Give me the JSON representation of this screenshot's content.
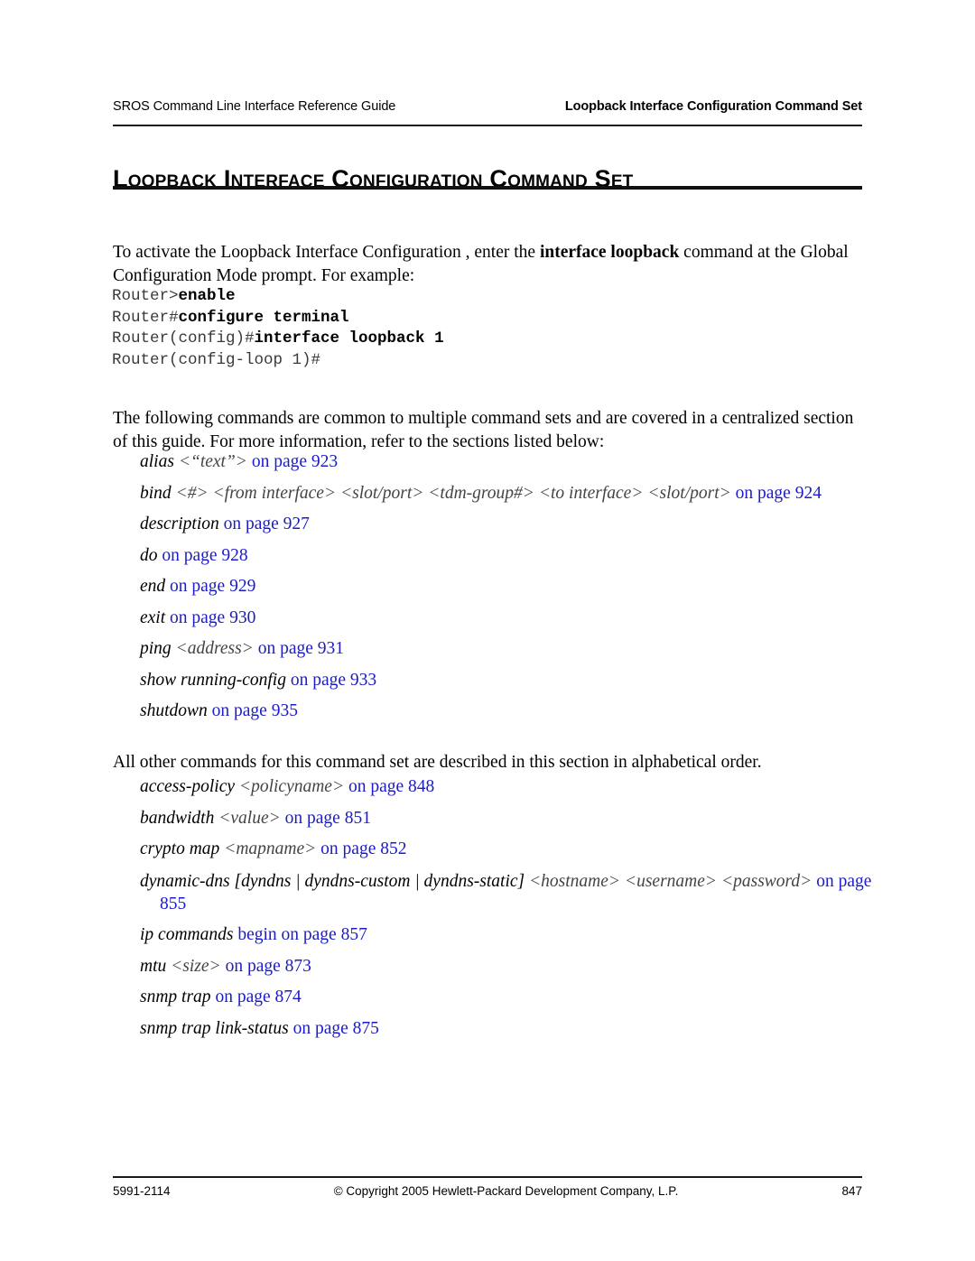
{
  "header": {
    "left": "SROS Command Line Interface Reference Guide",
    "right": "Loopback Interface Configuration Command Set"
  },
  "title": "Loopback Interface Configuration Command Set",
  "paragraphs": {
    "intro_before": "To activate the Loopback Interface Configuration , enter the ",
    "intro_bold": "interface loopback",
    "intro_after": " command at the Global Configuration Mode prompt. For example:",
    "common": "The following commands are common to multiple command sets and are covered in a centralized section of this guide. For more information, refer to the sections listed below:",
    "other": "All other commands for this command set are described in this section in alphabetical order."
  },
  "code_block": [
    {
      "prompt": "Router>",
      "typed": "enable"
    },
    {
      "prompt": "Router#",
      "typed": "configure terminal"
    },
    {
      "prompt": "Router(config)#",
      "typed": "interface loopback 1"
    },
    {
      "prompt": "Router(config-loop 1)#",
      "typed": ""
    }
  ],
  "common_commands": [
    {
      "cmd": "alias ",
      "arg": "<“text”>",
      "link": " on page 923"
    },
    {
      "cmd": "bind ",
      "arg": "<#> <from interface> <slot/port> <tdm-group#> <to interface> <slot/port>",
      "link": " on page 924"
    },
    {
      "cmd": "description",
      "arg": "",
      "link": " on page 927"
    },
    {
      "cmd": "do",
      "arg": "",
      "link": " on page 928"
    },
    {
      "cmd": "end",
      "arg": "",
      "link": " on page 929"
    },
    {
      "cmd": "exit",
      "arg": "",
      "link": " on page 930"
    },
    {
      "cmd": "ping ",
      "arg": "<address>",
      "link": " on page 931"
    },
    {
      "cmd": "show running-config",
      "arg": "",
      "link": " on page 933"
    },
    {
      "cmd": "shutdown",
      "arg": "",
      "link": " on page 935"
    }
  ],
  "other_commands": [
    {
      "cmd": "access-policy ",
      "arg": "<policyname>",
      "link": " on page 848",
      "wrapped": false
    },
    {
      "cmd": "bandwidth ",
      "arg": "<value>",
      "link": " on page 851",
      "wrapped": false
    },
    {
      "cmd": "crypto map ",
      "arg": "<mapname>",
      "link": " on page 852",
      "wrapped": false
    },
    {
      "cmd": "dynamic-dns [dyndns | dyndns-custom | dyndns-static] ",
      "arg": "<hostname> <username> <password>",
      "link": " on page 855",
      "wrapped": true
    },
    {
      "cmd": "ip commands",
      "arg": "",
      "link": " begin on page 857",
      "wrapped": false
    },
    {
      "cmd": "mtu ",
      "arg": "<size>",
      "link": " on page 873",
      "wrapped": false
    },
    {
      "cmd": "snmp trap",
      "arg": "",
      "link": " on page 874",
      "wrapped": false
    },
    {
      "cmd": "snmp trap link-status",
      "arg": "",
      "link": " on page 875",
      "wrapped": false
    }
  ],
  "footer": {
    "left": "5991-2114",
    "center": "© Copyright 2005 Hewlett-Packard Development Company, L.P.",
    "right": "847"
  },
  "colors": {
    "link": "#1b1bc8",
    "text": "#000000",
    "rule": "#1a1a1a"
  }
}
